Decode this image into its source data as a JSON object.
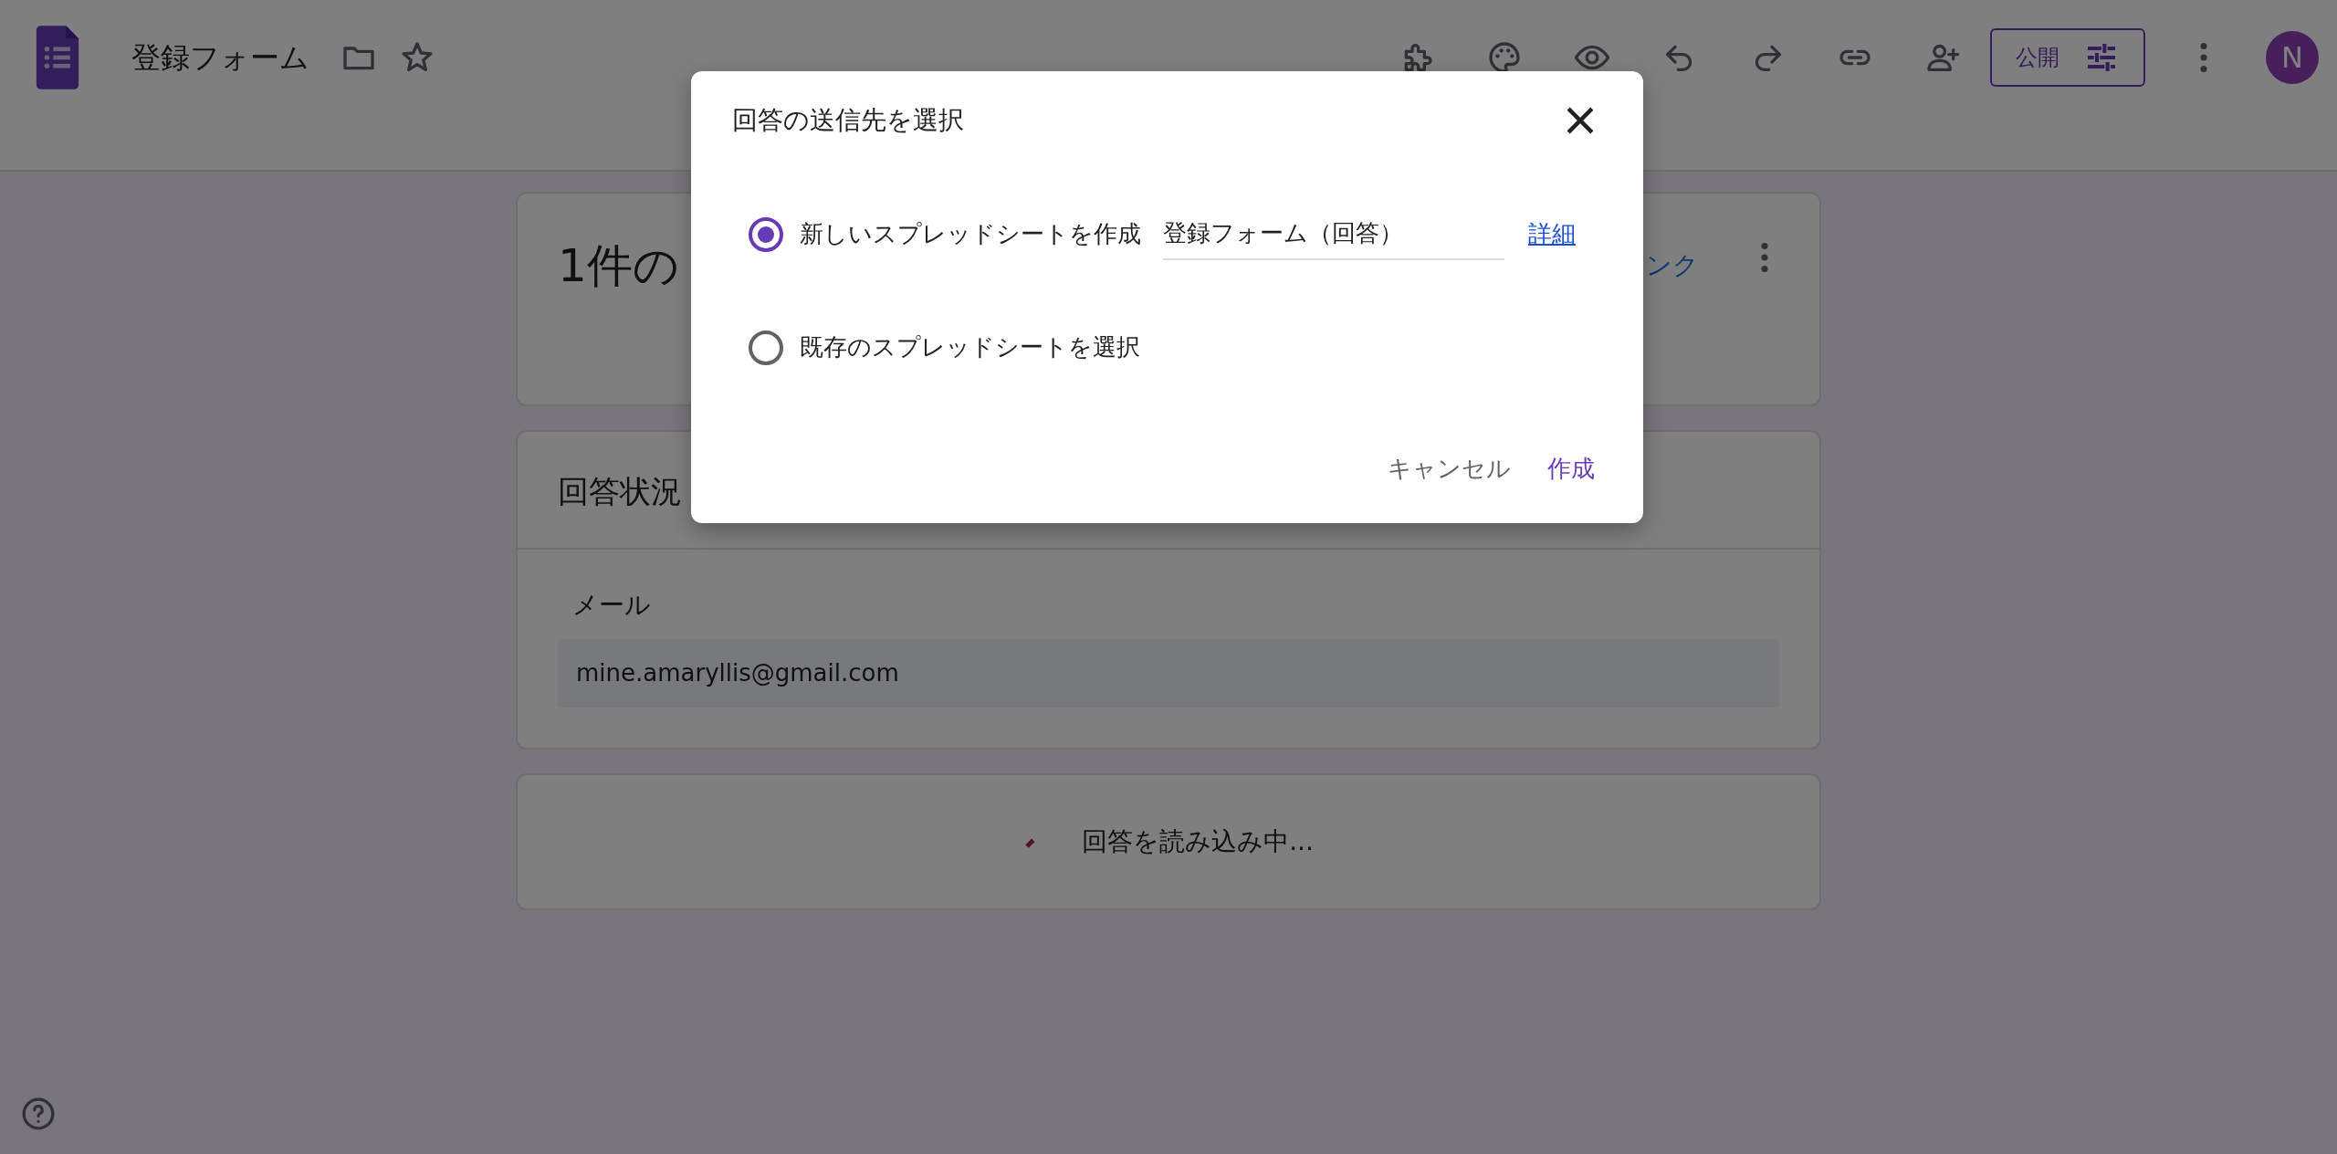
{
  "app": {
    "title": "登録フォーム"
  },
  "toolbar": {
    "publish_button": "公開",
    "avatar": "N"
  },
  "summary_card": {
    "title": "1件の",
    "link": "ンク"
  },
  "status_card": {
    "title": "回答状況",
    "field_label": "メール",
    "field_value": "mine.amaryllis@gmail.com"
  },
  "loading_card": {
    "text": "回答を読み込み中..."
  },
  "dialog": {
    "title": "回答の送信先を選択",
    "options": [
      {
        "label": "新しいスプレッドシートを作成",
        "selected": true,
        "value": "登録フォーム（回答）",
        "link": "詳細"
      },
      {
        "label": "既存のスプレッドシートを選択",
        "selected": false
      }
    ],
    "buttons": [
      {
        "label": "キャンセル",
        "kind": "secondary"
      },
      {
        "label": "作成",
        "kind": "primary"
      }
    ]
  }
}
